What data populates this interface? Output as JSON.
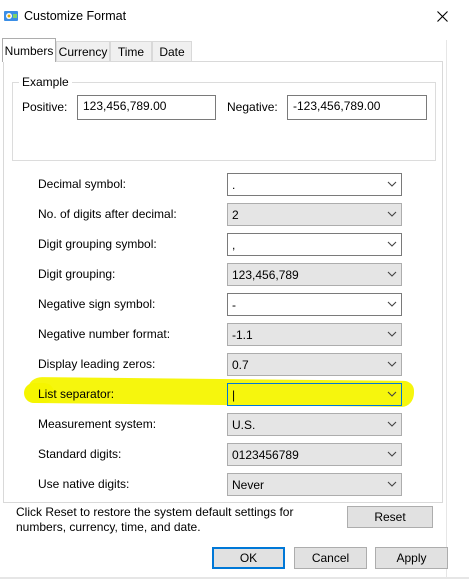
{
  "window": {
    "title": "Customize Format",
    "icon": "control-panel-icon",
    "close_icon": "close-icon"
  },
  "tabs": [
    {
      "label": "Numbers",
      "active": true
    },
    {
      "label": "Currency",
      "active": false
    },
    {
      "label": "Time",
      "active": false
    },
    {
      "label": "Date",
      "active": false
    }
  ],
  "example": {
    "legend": "Example",
    "positive_label": "Positive:",
    "positive_value": "123,456,789.00",
    "negative_label": "Negative:",
    "negative_value": "-123,456,789.00"
  },
  "settings": [
    {
      "label": "Decimal symbol:",
      "value": ".",
      "kind": "edit"
    },
    {
      "label": "No. of digits after decimal:",
      "value": "2",
      "kind": "list"
    },
    {
      "label": "Digit grouping symbol:",
      "value": ",",
      "kind": "edit"
    },
    {
      "label": "Digit grouping:",
      "value": "123,456,789",
      "kind": "list"
    },
    {
      "label": "Negative sign symbol:",
      "value": "-",
      "kind": "edit"
    },
    {
      "label": "Negative number format:",
      "value": "-1.1",
      "kind": "list"
    },
    {
      "label": "Display leading zeros:",
      "value": "0.7",
      "kind": "list"
    },
    {
      "label": "List separator:",
      "value": "|",
      "kind": "edit",
      "focused": true,
      "highlighted": true
    },
    {
      "label": "Measurement system:",
      "value": "U.S.",
      "kind": "list"
    },
    {
      "label": "Standard digits:",
      "value": "0123456789",
      "kind": "list"
    },
    {
      "label": "Use native digits:",
      "value": "Never",
      "kind": "list"
    }
  ],
  "reset": {
    "text": "Click Reset to restore the system default settings for numbers, currency, time, and date.",
    "button_label": "Reset"
  },
  "buttons": {
    "ok": "OK",
    "cancel": "Cancel",
    "apply": "Apply"
  },
  "colors": {
    "highlight": "#f5f500",
    "focus_border": "#0078d7"
  }
}
